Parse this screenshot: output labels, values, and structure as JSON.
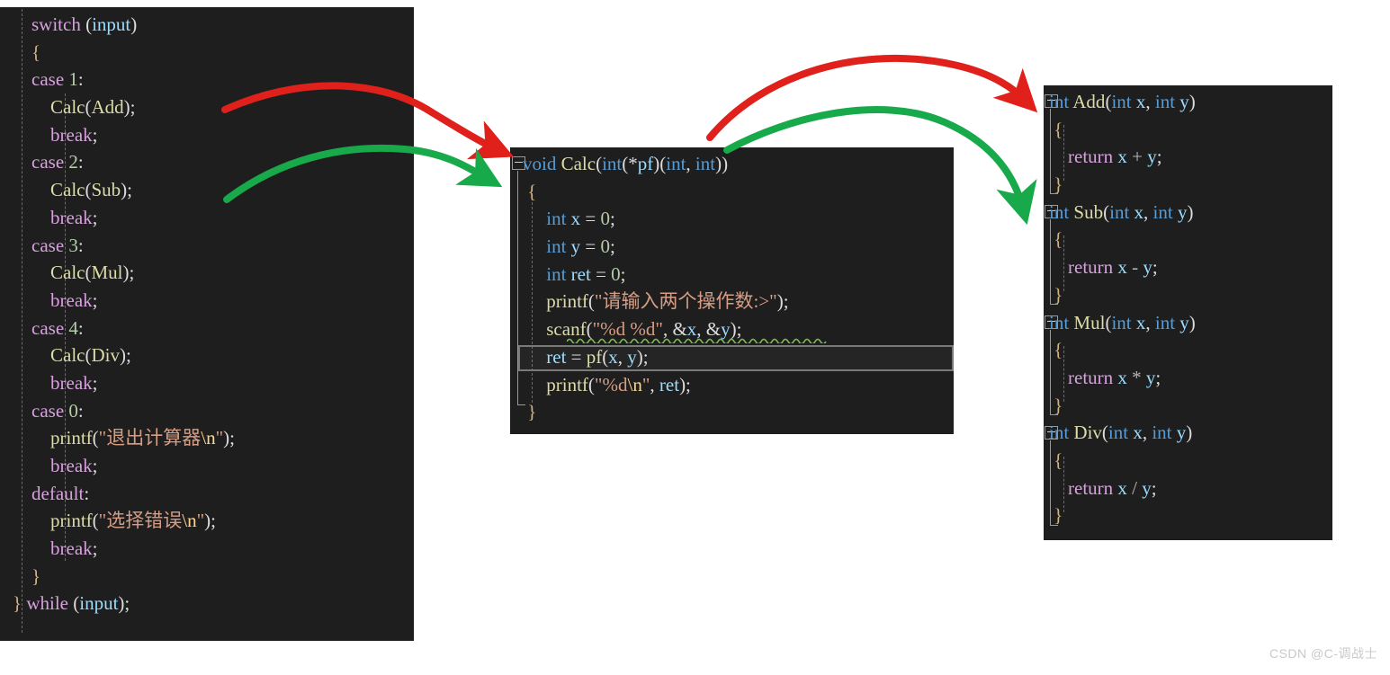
{
  "meta": {
    "background": "#ffffff",
    "editor_background": "#1e1e1e",
    "arrow_red": "#e0201b",
    "arrow_green": "#18a94b"
  },
  "watermark": {
    "text": "CSDN @C-调战士"
  },
  "panels": {
    "left": {
      "name": "switch-statement-panel",
      "lines": [
        [
          {
            "t": "    ",
            "c": "pl"
          },
          {
            "t": "switch",
            "c": "kw"
          },
          {
            "t": " (",
            "c": "pl"
          },
          {
            "t": "input",
            "c": "var"
          },
          {
            "t": ")",
            "c": "pl"
          }
        ],
        [
          {
            "t": "    {",
            "c": "brc"
          }
        ],
        [
          {
            "t": "    ",
            "c": "pl"
          },
          {
            "t": "case",
            "c": "kw"
          },
          {
            "t": " ",
            "c": "pl"
          },
          {
            "t": "1",
            "c": "num"
          },
          {
            "t": ":",
            "c": "pl"
          }
        ],
        [
          {
            "t": "        ",
            "c": "pl"
          },
          {
            "t": "Calc",
            "c": "fn"
          },
          {
            "t": "(",
            "c": "pl"
          },
          {
            "t": "Add",
            "c": "fn"
          },
          {
            "t": ");",
            "c": "pl"
          }
        ],
        [
          {
            "t": "        ",
            "c": "pl"
          },
          {
            "t": "break",
            "c": "kw"
          },
          {
            "t": ";",
            "c": "pl"
          }
        ],
        [
          {
            "t": "    ",
            "c": "pl"
          },
          {
            "t": "case",
            "c": "kw"
          },
          {
            "t": " ",
            "c": "pl"
          },
          {
            "t": "2",
            "c": "num"
          },
          {
            "t": ":",
            "c": "pl"
          }
        ],
        [
          {
            "t": "        ",
            "c": "pl"
          },
          {
            "t": "Calc",
            "c": "fn"
          },
          {
            "t": "(",
            "c": "pl"
          },
          {
            "t": "Sub",
            "c": "fn"
          },
          {
            "t": ");",
            "c": "pl"
          }
        ],
        [
          {
            "t": "        ",
            "c": "pl"
          },
          {
            "t": "break",
            "c": "kw"
          },
          {
            "t": ";",
            "c": "pl"
          }
        ],
        [
          {
            "t": "    ",
            "c": "pl"
          },
          {
            "t": "case",
            "c": "kw"
          },
          {
            "t": " ",
            "c": "pl"
          },
          {
            "t": "3",
            "c": "num"
          },
          {
            "t": ":",
            "c": "pl"
          }
        ],
        [
          {
            "t": "        ",
            "c": "pl"
          },
          {
            "t": "Calc",
            "c": "fn"
          },
          {
            "t": "(",
            "c": "pl"
          },
          {
            "t": "Mul",
            "c": "fn"
          },
          {
            "t": ");",
            "c": "pl"
          }
        ],
        [
          {
            "t": "        ",
            "c": "pl"
          },
          {
            "t": "break",
            "c": "kw"
          },
          {
            "t": ";",
            "c": "pl"
          }
        ],
        [
          {
            "t": "    ",
            "c": "pl"
          },
          {
            "t": "case",
            "c": "kw"
          },
          {
            "t": " ",
            "c": "pl"
          },
          {
            "t": "4",
            "c": "num"
          },
          {
            "t": ":",
            "c": "pl"
          }
        ],
        [
          {
            "t": "        ",
            "c": "pl"
          },
          {
            "t": "Calc",
            "c": "fn"
          },
          {
            "t": "(",
            "c": "pl"
          },
          {
            "t": "Div",
            "c": "fn"
          },
          {
            "t": ");",
            "c": "pl"
          }
        ],
        [
          {
            "t": "        ",
            "c": "pl"
          },
          {
            "t": "break",
            "c": "kw"
          },
          {
            "t": ";",
            "c": "pl"
          }
        ],
        [
          {
            "t": "    ",
            "c": "pl"
          },
          {
            "t": "case",
            "c": "kw"
          },
          {
            "t": " ",
            "c": "pl"
          },
          {
            "t": "0",
            "c": "num"
          },
          {
            "t": ":",
            "c": "pl"
          }
        ],
        [
          {
            "t": "        ",
            "c": "pl"
          },
          {
            "t": "printf",
            "c": "fn"
          },
          {
            "t": "(",
            "c": "pl"
          },
          {
            "t": "\"退出计算器",
            "c": "str"
          },
          {
            "t": "\\n",
            "c": "esc"
          },
          {
            "t": "\"",
            "c": "str"
          },
          {
            "t": ");",
            "c": "pl"
          }
        ],
        [
          {
            "t": "        ",
            "c": "pl"
          },
          {
            "t": "break",
            "c": "kw"
          },
          {
            "t": ";",
            "c": "pl"
          }
        ],
        [
          {
            "t": "    ",
            "c": "pl"
          },
          {
            "t": "default",
            "c": "kw"
          },
          {
            "t": ":",
            "c": "pl"
          }
        ],
        [
          {
            "t": "        ",
            "c": "pl"
          },
          {
            "t": "printf",
            "c": "fn"
          },
          {
            "t": "(",
            "c": "pl"
          },
          {
            "t": "\"选择错误",
            "c": "str"
          },
          {
            "t": "\\n",
            "c": "esc"
          },
          {
            "t": "\"",
            "c": "str"
          },
          {
            "t": ");",
            "c": "pl"
          }
        ],
        [
          {
            "t": "        ",
            "c": "pl"
          },
          {
            "t": "break",
            "c": "kw"
          },
          {
            "t": ";",
            "c": "pl"
          }
        ],
        [
          {
            "t": "    }",
            "c": "brc"
          }
        ],
        [
          {
            "t": "} ",
            "c": "brc"
          },
          {
            "t": "while",
            "c": "kw"
          },
          {
            "t": " (",
            "c": "pl"
          },
          {
            "t": "input",
            "c": "var"
          },
          {
            "t": ");",
            "c": "pl"
          }
        ]
      ]
    },
    "middle": {
      "name": "calc-function-panel",
      "current_line_index": 8,
      "lines": [
        [
          {
            "t": "void",
            "c": "typ"
          },
          {
            "t": " ",
            "c": "pl"
          },
          {
            "t": "Calc",
            "c": "fn"
          },
          {
            "t": "(",
            "c": "pl"
          },
          {
            "t": "int",
            "c": "typ"
          },
          {
            "t": "(*",
            "c": "pl"
          },
          {
            "t": "pf",
            "c": "var"
          },
          {
            "t": ")(",
            "c": "pl"
          },
          {
            "t": "int",
            "c": "typ"
          },
          {
            "t": ", ",
            "c": "pl"
          },
          {
            "t": "int",
            "c": "typ"
          },
          {
            "t": "))",
            "c": "pl"
          }
        ],
        [
          {
            "t": " {",
            "c": "brc"
          }
        ],
        [
          {
            "t": "     ",
            "c": "pl"
          },
          {
            "t": "int",
            "c": "typ"
          },
          {
            "t": " ",
            "c": "pl"
          },
          {
            "t": "x",
            "c": "var"
          },
          {
            "t": " = ",
            "c": "pl"
          },
          {
            "t": "0",
            "c": "num"
          },
          {
            "t": ";",
            "c": "pl"
          }
        ],
        [
          {
            "t": "     ",
            "c": "pl"
          },
          {
            "t": "int",
            "c": "typ"
          },
          {
            "t": " ",
            "c": "pl"
          },
          {
            "t": "y",
            "c": "var"
          },
          {
            "t": " = ",
            "c": "pl"
          },
          {
            "t": "0",
            "c": "num"
          },
          {
            "t": ";",
            "c": "pl"
          }
        ],
        [
          {
            "t": "     ",
            "c": "pl"
          },
          {
            "t": "int",
            "c": "typ"
          },
          {
            "t": " ",
            "c": "pl"
          },
          {
            "t": "ret",
            "c": "var"
          },
          {
            "t": " = ",
            "c": "pl"
          },
          {
            "t": "0",
            "c": "num"
          },
          {
            "t": ";",
            "c": "pl"
          }
        ],
        [
          {
            "t": "     ",
            "c": "pl"
          },
          {
            "t": "printf",
            "c": "fn"
          },
          {
            "t": "(",
            "c": "pl"
          },
          {
            "t": "\"请输入两个操作数:>\"",
            "c": "str"
          },
          {
            "t": ");",
            "c": "pl"
          }
        ],
        [
          {
            "t": "     ",
            "c": "pl"
          },
          {
            "t": "scanf",
            "c": "fn"
          },
          {
            "t": "(",
            "c": "pl"
          },
          {
            "t": "\"%d %d\"",
            "c": "str"
          },
          {
            "t": ", &",
            "c": "pl"
          },
          {
            "t": "x",
            "c": "var"
          },
          {
            "t": ", &",
            "c": "pl"
          },
          {
            "t": "y",
            "c": "var"
          },
          {
            "t": ");",
            "c": "pl"
          }
        ],
        [
          {
            "t": "     ",
            "c": "pl"
          },
          {
            "t": "ret",
            "c": "var"
          },
          {
            "t": " = ",
            "c": "pl"
          },
          {
            "t": "pf",
            "c": "fn"
          },
          {
            "t": "(",
            "c": "pl"
          },
          {
            "t": "x",
            "c": "var"
          },
          {
            "t": ", ",
            "c": "pl"
          },
          {
            "t": "y",
            "c": "var"
          },
          {
            "t": ");",
            "c": "pl"
          }
        ],
        [
          {
            "t": "     ",
            "c": "pl"
          },
          {
            "t": "printf",
            "c": "fn"
          },
          {
            "t": "(",
            "c": "pl"
          },
          {
            "t": "\"%d",
            "c": "str"
          },
          {
            "t": "\\n",
            "c": "esc"
          },
          {
            "t": "\"",
            "c": "str"
          },
          {
            "t": ", ",
            "c": "pl"
          },
          {
            "t": "ret",
            "c": "var"
          },
          {
            "t": ");",
            "c": "pl"
          }
        ],
        [
          {
            "t": " }",
            "c": "brc"
          }
        ]
      ]
    },
    "right": {
      "name": "operation-functions-panel",
      "lines": [
        [
          {
            "t": "int",
            "c": "typ"
          },
          {
            "t": " ",
            "c": "pl"
          },
          {
            "t": "Add",
            "c": "fn"
          },
          {
            "t": "(",
            "c": "pl"
          },
          {
            "t": "int",
            "c": "typ"
          },
          {
            "t": " ",
            "c": "pl"
          },
          {
            "t": "x",
            "c": "var"
          },
          {
            "t": ", ",
            "c": "pl"
          },
          {
            "t": "int",
            "c": "typ"
          },
          {
            "t": " ",
            "c": "pl"
          },
          {
            "t": "y",
            "c": "var"
          },
          {
            "t": ")",
            "c": "pl"
          }
        ],
        [
          {
            "t": " {",
            "c": "brc"
          }
        ],
        [
          {
            "t": "    ",
            "c": "pl"
          },
          {
            "t": "return",
            "c": "kw"
          },
          {
            "t": " ",
            "c": "pl"
          },
          {
            "t": "x",
            "c": "var"
          },
          {
            "t": " + ",
            "c": "op"
          },
          {
            "t": "y",
            "c": "var"
          },
          {
            "t": ";",
            "c": "pl"
          }
        ],
        [
          {
            "t": " }",
            "c": "brc"
          }
        ],
        [
          {
            "t": "int",
            "c": "typ"
          },
          {
            "t": " ",
            "c": "pl"
          },
          {
            "t": "Sub",
            "c": "fn"
          },
          {
            "t": "(",
            "c": "pl"
          },
          {
            "t": "int",
            "c": "typ"
          },
          {
            "t": " ",
            "c": "pl"
          },
          {
            "t": "x",
            "c": "var"
          },
          {
            "t": ", ",
            "c": "pl"
          },
          {
            "t": "int",
            "c": "typ"
          },
          {
            "t": " ",
            "c": "pl"
          },
          {
            "t": "y",
            "c": "var"
          },
          {
            "t": ")",
            "c": "pl"
          }
        ],
        [
          {
            "t": " {",
            "c": "brc"
          }
        ],
        [
          {
            "t": "    ",
            "c": "pl"
          },
          {
            "t": "return",
            "c": "kw"
          },
          {
            "t": " ",
            "c": "pl"
          },
          {
            "t": "x",
            "c": "var"
          },
          {
            "t": " - ",
            "c": "op"
          },
          {
            "t": "y",
            "c": "var"
          },
          {
            "t": ";",
            "c": "pl"
          }
        ],
        [
          {
            "t": " }",
            "c": "brc"
          }
        ],
        [
          {
            "t": "int",
            "c": "typ"
          },
          {
            "t": " ",
            "c": "pl"
          },
          {
            "t": "Mul",
            "c": "fn"
          },
          {
            "t": "(",
            "c": "pl"
          },
          {
            "t": "int",
            "c": "typ"
          },
          {
            "t": " ",
            "c": "pl"
          },
          {
            "t": "x",
            "c": "var"
          },
          {
            "t": ", ",
            "c": "pl"
          },
          {
            "t": "int",
            "c": "typ"
          },
          {
            "t": " ",
            "c": "pl"
          },
          {
            "t": "y",
            "c": "var"
          },
          {
            "t": ")",
            "c": "pl"
          }
        ],
        [
          {
            "t": " {",
            "c": "brc"
          }
        ],
        [
          {
            "t": "    ",
            "c": "pl"
          },
          {
            "t": "return",
            "c": "kw"
          },
          {
            "t": " ",
            "c": "pl"
          },
          {
            "t": "x",
            "c": "var"
          },
          {
            "t": " * ",
            "c": "op"
          },
          {
            "t": "y",
            "c": "var"
          },
          {
            "t": ";",
            "c": "pl"
          }
        ],
        [
          {
            "t": " }",
            "c": "brc"
          }
        ],
        [
          {
            "t": "int",
            "c": "typ"
          },
          {
            "t": " ",
            "c": "pl"
          },
          {
            "t": "Div",
            "c": "fn"
          },
          {
            "t": "(",
            "c": "pl"
          },
          {
            "t": "int",
            "c": "typ"
          },
          {
            "t": " ",
            "c": "pl"
          },
          {
            "t": "x",
            "c": "var"
          },
          {
            "t": ", ",
            "c": "pl"
          },
          {
            "t": "int",
            "c": "typ"
          },
          {
            "t": " ",
            "c": "pl"
          },
          {
            "t": "y",
            "c": "var"
          },
          {
            "t": ")",
            "c": "pl"
          }
        ],
        [
          {
            "t": " {",
            "c": "brc"
          }
        ],
        [
          {
            "t": "    ",
            "c": "pl"
          },
          {
            "t": "return",
            "c": "kw"
          },
          {
            "t": " ",
            "c": "pl"
          },
          {
            "t": "x",
            "c": "var"
          },
          {
            "t": " / ",
            "c": "op"
          },
          {
            "t": "y",
            "c": "var"
          },
          {
            "t": ";",
            "c": "pl"
          }
        ],
        [
          {
            "t": " }",
            "c": "brc"
          }
        ]
      ]
    }
  },
  "annotations": {
    "arrows": [
      {
        "name": "arrow-add-to-calc",
        "color": "#e0201b",
        "from": "Calc(Add)",
        "to": "void Calc(...)"
      },
      {
        "name": "arrow-sub-to-calc",
        "color": "#18a94b",
        "from": "Calc(Sub)",
        "to": "void Calc(...)"
      },
      {
        "name": "arrow-calc-to-add",
        "color": "#e0201b",
        "from": "void Calc(...)",
        "to": "int Add(int x, int y)"
      },
      {
        "name": "arrow-calc-to-sub",
        "color": "#18a94b",
        "from": "void Calc(...)",
        "to": "int Sub(int x, int y)"
      }
    ]
  }
}
